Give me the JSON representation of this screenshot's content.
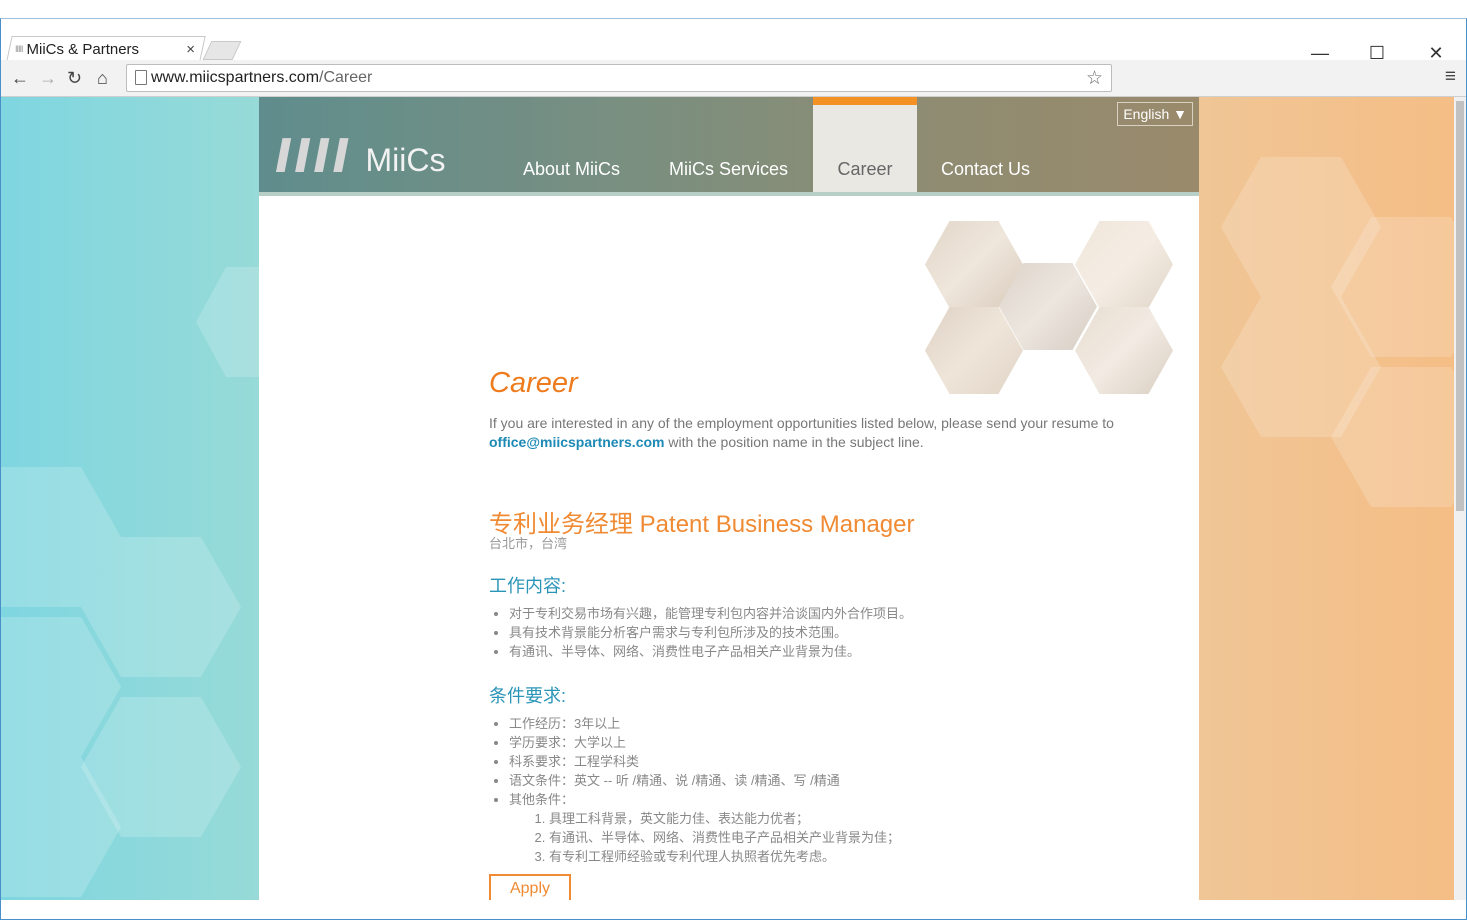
{
  "browser": {
    "tab_title": "MiiCs & Partners",
    "tab_close": "×",
    "url_host": "www.miicspartners.com",
    "url_path": "/Career",
    "minimize": "—",
    "maximize": "☐",
    "close": "✕"
  },
  "header": {
    "logo_bars": "IIII",
    "logo_text": "MiiCs",
    "language": "English ▼",
    "nav": [
      {
        "label": "About MiiCs",
        "active": false
      },
      {
        "label": "MiiCs Services",
        "active": false
      },
      {
        "label": "Career",
        "active": true
      },
      {
        "label": "Contact Us",
        "active": false
      }
    ]
  },
  "page": {
    "title": "Career",
    "intro_before": "If you are interested in any of the employment opportunities listed below, please send your resume to",
    "email": "office@miicspartners.com",
    "intro_after": "with the position name in the subject line."
  },
  "job": {
    "title": "专利业务经理 Patent Business Manager",
    "location": "台北市，台湾",
    "duties_heading": "工作内容:",
    "duties": [
      "对于专利交易市场有兴趣，能管理专利包内容并洽谈国内外合作项目。",
      "具有技术背景能分析客户需求与专利包所涉及的技术范围。",
      "有通讯、半导体、网络、消费性电子产品相关产业背景为佳。"
    ],
    "requirements_heading": "条件要求:",
    "requirements": [
      "工作经历：3年以上",
      "学历要求：大学以上",
      "科系要求：工程学科类",
      "语文条件：英文 -- 听 /精通、说 /精通、读 /精通、写 /精通",
      "其他条件："
    ],
    "other_conditions": [
      "具理工科背景，英文能力佳、表达能力优者；",
      "有通讯、半导体、网络、消费性电子产品相关产业背景为佳；",
      "有专利工程师经验或专利代理人执照者优先考虑。"
    ],
    "apply_label": "Apply"
  },
  "colors": {
    "accent_orange": "#f08a33",
    "link_blue": "#1d8ab6",
    "heading_blue": "#2b95b8"
  },
  "icons": [
    "back-icon",
    "forward-icon",
    "reload-icon",
    "home-icon",
    "page-icon",
    "star-icon",
    "menu-icon"
  ]
}
